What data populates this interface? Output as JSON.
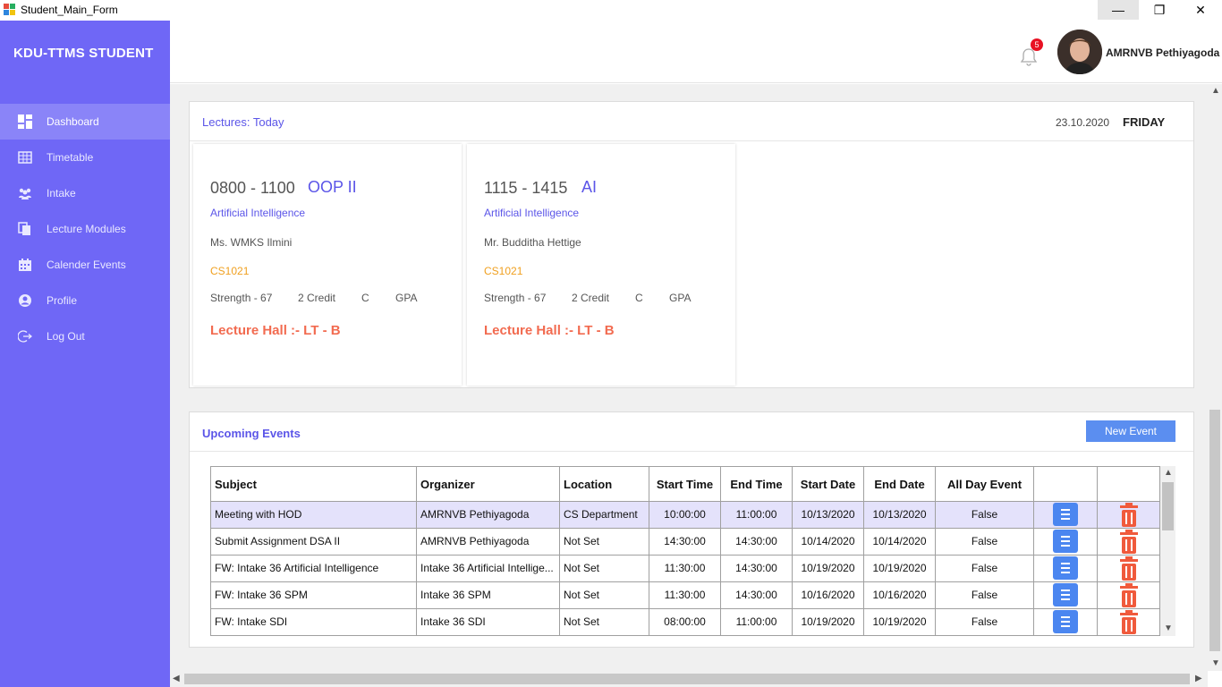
{
  "window": {
    "title": "Student_Main_Form",
    "min_label": "—",
    "max_label": "❐",
    "close_label": "✕"
  },
  "sidebar": {
    "brand": "KDU-TTMS STUDENT",
    "items": [
      {
        "label": "Dashboard",
        "icon": "dashboard-icon",
        "active": true
      },
      {
        "label": "Timetable",
        "icon": "timetable-icon"
      },
      {
        "label": "Intake",
        "icon": "intake-icon"
      },
      {
        "label": "Lecture Modules",
        "icon": "modules-icon"
      },
      {
        "label": "Calender Events",
        "icon": "calendar-icon"
      },
      {
        "label": "Profile",
        "icon": "profile-icon"
      },
      {
        "label": "Log Out",
        "icon": "logout-icon"
      }
    ],
    "color": "#6f67f6"
  },
  "header": {
    "notification_count": "5",
    "username": "AMRNVB Pethiyagoda"
  },
  "lectures": {
    "title": "Lectures: Today",
    "date": "23.10.2020",
    "day": "FRIDAY",
    "cards": [
      {
        "time": "0800 - 1100",
        "code": "OOP II",
        "subject": "Artificial Intelligence",
        "lecturer": "Ms. WMKS Ilmini",
        "course": "CS1021",
        "strength": "Strength - 67",
        "credit": "2 Credit",
        "grade": "C",
        "gpa": "GPA",
        "hall": "Lecture Hall :- LT - B"
      },
      {
        "time": "1115 - 1415",
        "code": "AI",
        "subject": "Artificial Intelligence",
        "lecturer": "Mr. Budditha Hettige",
        "course": "CS1021",
        "strength": "Strength - 67",
        "credit": "2 Credit",
        "grade": "C",
        "gpa": "GPA",
        "hall": "Lecture Hall :- LT - B"
      }
    ]
  },
  "events": {
    "title": "Upcoming Events",
    "new_button": "New Event",
    "columns": [
      "Subject",
      "Organizer",
      "Location",
      "Start Time",
      "End Time",
      "Start Date",
      "End Date",
      "All Day Event"
    ],
    "rows": [
      [
        "Meeting with HOD",
        "AMRNVB Pethiyagoda",
        "CS Department",
        "10:00:00",
        "11:00:00",
        "10/13/2020",
        "10/13/2020",
        "False"
      ],
      [
        "Submit Assignment DSA II",
        "AMRNVB Pethiyagoda",
        "Not Set",
        "14:30:00",
        "14:30:00",
        "10/14/2020",
        "10/14/2020",
        "False"
      ],
      [
        "FW: Intake 36 Artificial Intelligence",
        "Intake 36 Artificial Intellige...",
        "Not Set",
        "11:30:00",
        "14:30:00",
        "10/19/2020",
        "10/19/2020",
        "False"
      ],
      [
        "FW: Intake 36 SPM",
        "Intake 36 SPM",
        "Not Set",
        "11:30:00",
        "14:30:00",
        "10/16/2020",
        "10/16/2020",
        "False"
      ],
      [
        "FW: Intake SDI",
        "Intake 36 SDI",
        "Not Set",
        "08:00:00",
        "11:00:00",
        "10/19/2020",
        "10/19/2020",
        "False"
      ]
    ],
    "edit_icon": "menu-icon",
    "delete_icon": "trash-icon",
    "delete_color": "#f05a3c",
    "edit_color": "#4b86f0"
  }
}
